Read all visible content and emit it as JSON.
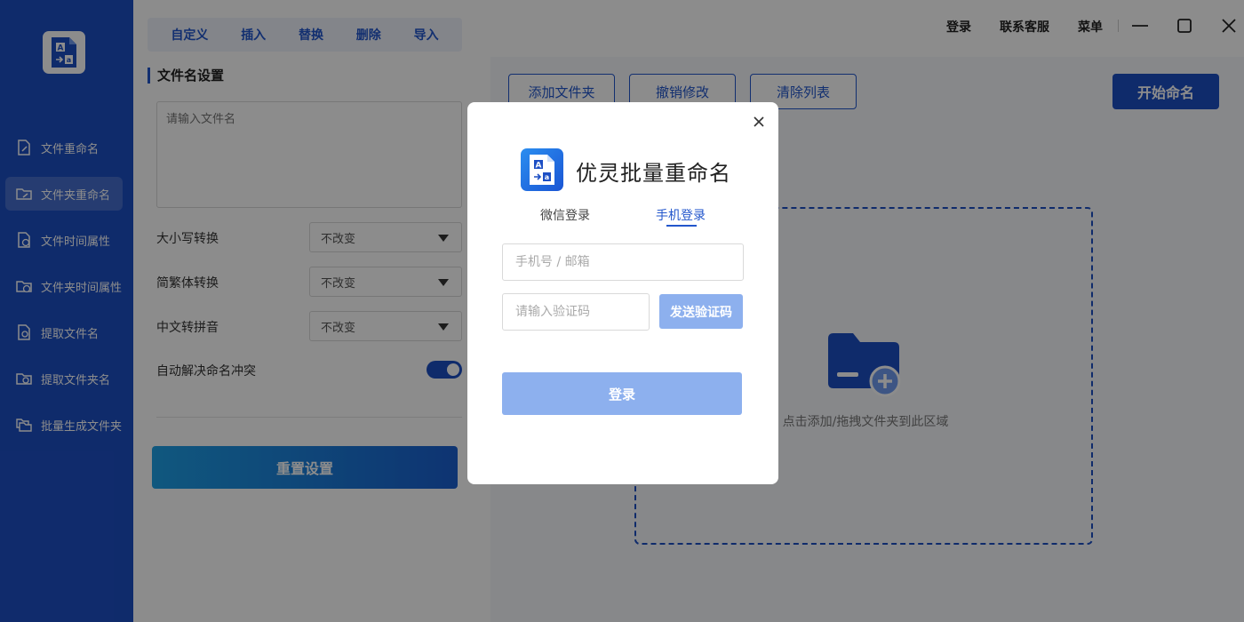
{
  "sidebar": {
    "items": [
      {
        "label": "文件重命名",
        "icon": "file-rename-icon"
      },
      {
        "label": "文件夹重命名",
        "icon": "folder-rename-icon",
        "active": true
      },
      {
        "label": "文件时间属性",
        "icon": "file-time-icon"
      },
      {
        "label": "文件夹时间属性",
        "icon": "folder-time-icon"
      },
      {
        "label": "提取文件名",
        "icon": "extract-filename-icon"
      },
      {
        "label": "提取文件夹名",
        "icon": "extract-foldername-icon"
      },
      {
        "label": "批量生成文件夹",
        "icon": "batch-folder-icon"
      }
    ]
  },
  "panel": {
    "ops": [
      "自定义",
      "插入",
      "替换",
      "删除",
      "导入"
    ],
    "section_title": "文件名设置",
    "filename_placeholder": "请输入文件名",
    "case_label": "大小写转换",
    "case_value": "不改变",
    "trad_label": "简繁体转换",
    "trad_value": "不改变",
    "pinyin_label": "中文转拼音",
    "pinyin_value": "不改变",
    "conflict_label": "自动解决命名冲突",
    "conflict_enabled": true,
    "reset_label": "重置设置"
  },
  "titlebar": {
    "login": "登录",
    "support": "联系客服",
    "menu": "菜单"
  },
  "main": {
    "add_folder": "添加文件夹",
    "undo": "撤销修改",
    "clear": "清除列表",
    "start": "开始命名",
    "drop_hint": "点击添加/拖拽文件夹到此区域"
  },
  "modal": {
    "title": "优灵批量重命名",
    "tab_wechat": "微信登录",
    "tab_phone": "手机登录",
    "phone_placeholder": "手机号 / 邮箱",
    "code_placeholder": "请输入验证码",
    "send_code": "发送验证码",
    "login": "登录"
  },
  "colors": {
    "primary": "#1d4fc4",
    "accent": "#2256cc",
    "disabled_button": "#8db0ee"
  }
}
